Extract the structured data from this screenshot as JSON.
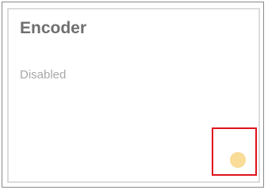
{
  "card": {
    "title": "Encoder",
    "status": "Disabled",
    "indicator": {
      "icon": "status-dot-icon",
      "color": "#f8dc97"
    }
  },
  "highlight": {
    "color": "#e0121c"
  }
}
